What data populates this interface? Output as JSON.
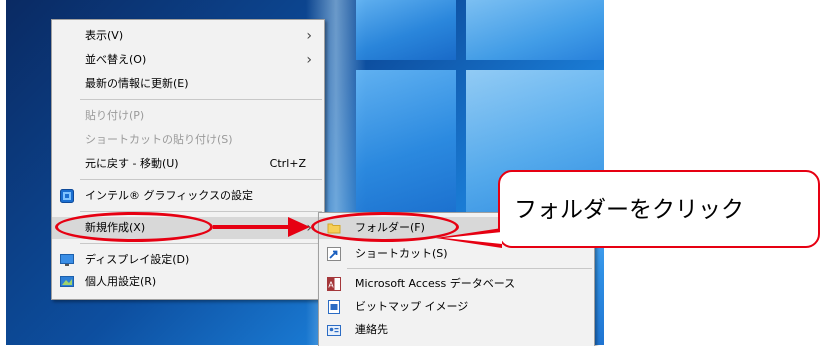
{
  "context_menu": {
    "items": [
      {
        "label": "表示(V)",
        "submenu": true
      },
      {
        "label": "並べ替え(O)",
        "submenu": true
      },
      {
        "label": "最新の情報に更新(E)"
      },
      {
        "label": "貼り付け(P)",
        "disabled": true
      },
      {
        "label": "ショートカットの貼り付け(S)",
        "disabled": true
      },
      {
        "label": "元に戻す - 移動(U)",
        "shortcut": "Ctrl+Z"
      },
      {
        "label": "インテル® グラフィックスの設定",
        "icon": "intel-graphics-icon"
      },
      {
        "label": "新規作成(X)",
        "submenu": true,
        "highlighted": true
      },
      {
        "label": "ディスプレイ設定(D)",
        "icon": "display-icon"
      },
      {
        "label": "個人用設定(R)",
        "icon": "personalize-icon"
      }
    ]
  },
  "submenu": {
    "items": [
      {
        "label": "フォルダー(F)",
        "icon": "folder-icon",
        "highlighted": true
      },
      {
        "label": "ショートカット(S)",
        "icon": "shortcut-icon"
      },
      {
        "label": "Microsoft Access データベース",
        "icon": "access-icon"
      },
      {
        "label": "ビットマップ イメージ",
        "icon": "bitmap-icon"
      },
      {
        "label": "連絡先",
        "icon": "contact-icon"
      }
    ]
  },
  "callout": {
    "text": "フォルダーをクリック"
  },
  "colors": {
    "annotation_red": "#e60012",
    "menu_bg": "#f2f2f2",
    "highlight": "#d8d8d8"
  }
}
